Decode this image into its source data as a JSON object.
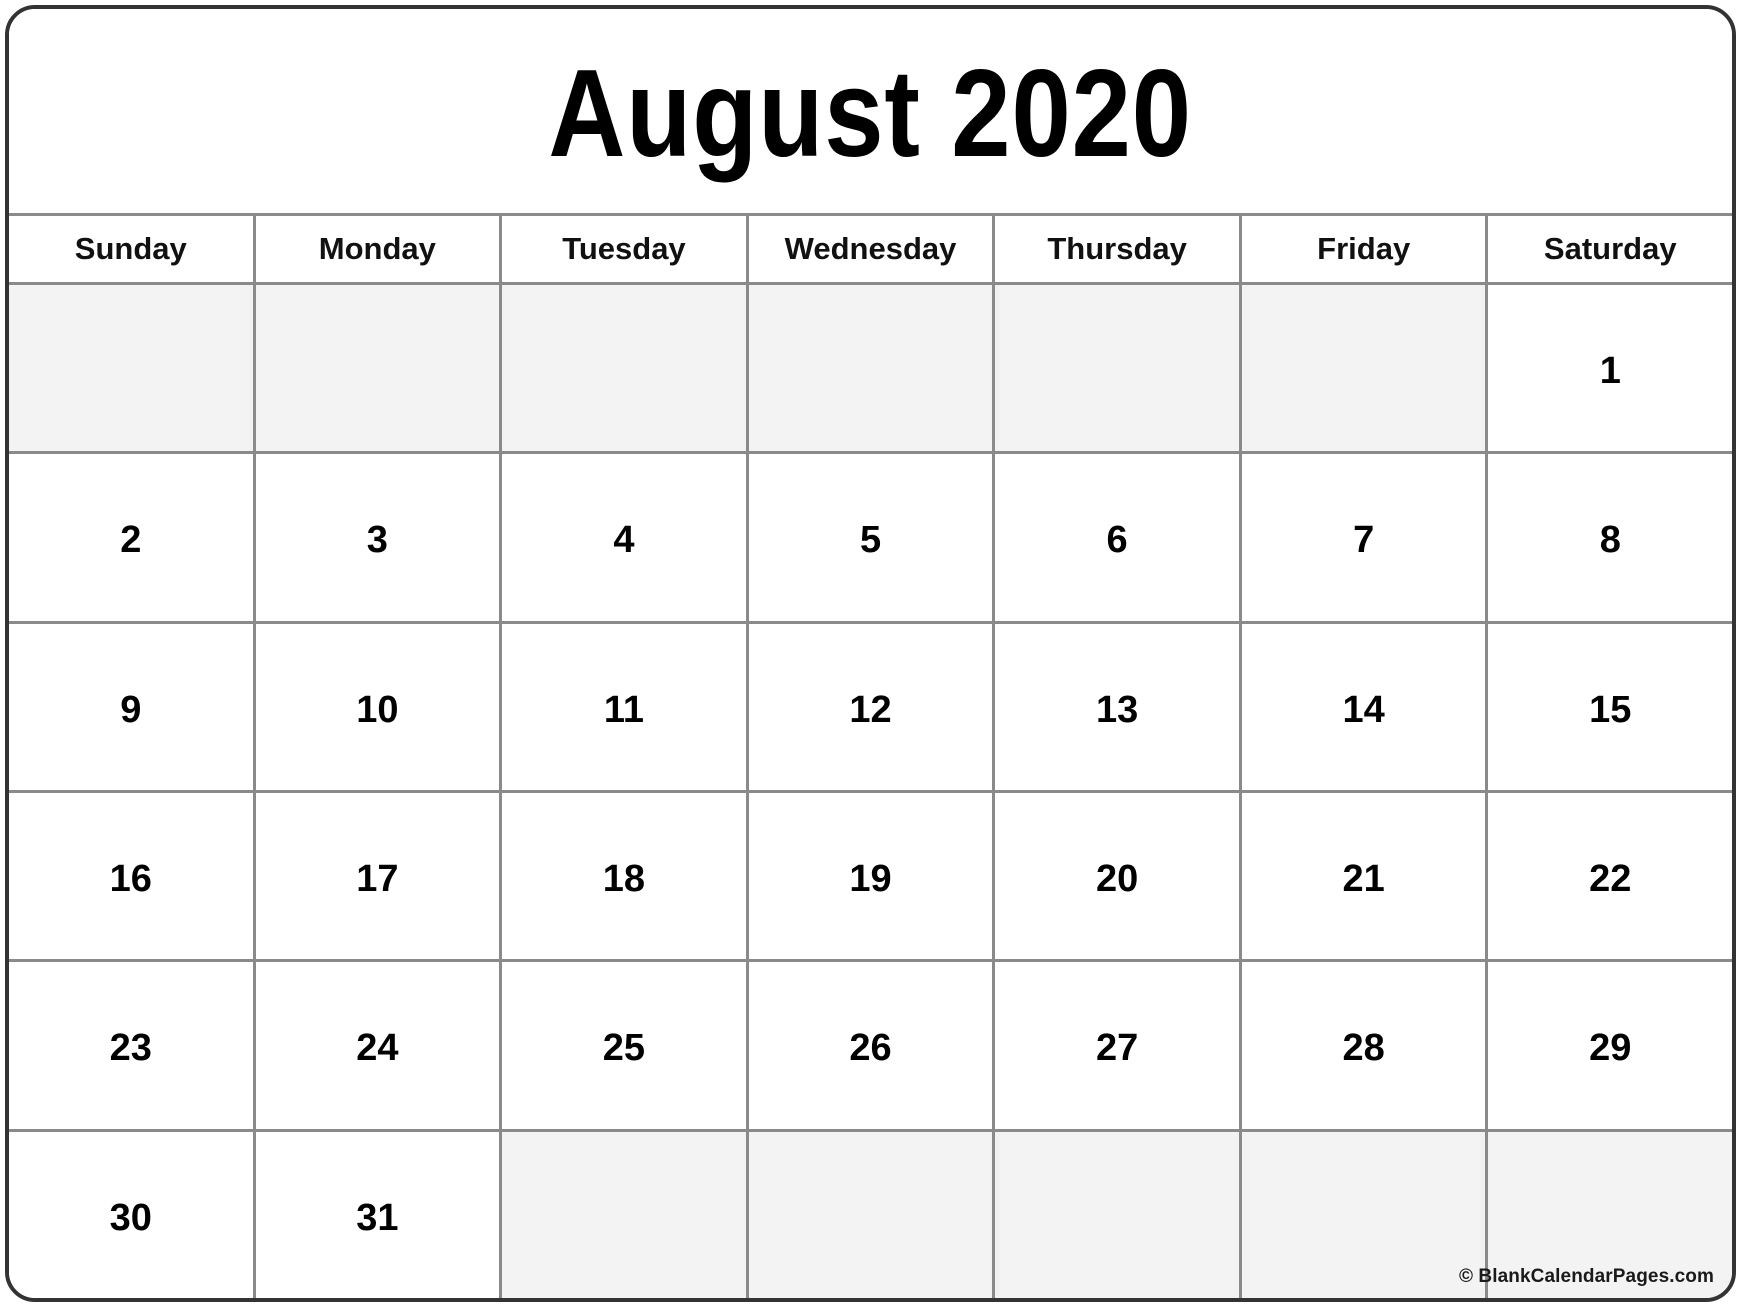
{
  "calendar": {
    "title": "August 2020",
    "month": "August",
    "year": "2020",
    "weekday_headers": [
      "Sunday",
      "Monday",
      "Tuesday",
      "Wednesday",
      "Thursday",
      "Friday",
      "Saturday"
    ],
    "weeks": [
      [
        {
          "day": "",
          "blank": true
        },
        {
          "day": "",
          "blank": true
        },
        {
          "day": "",
          "blank": true
        },
        {
          "day": "",
          "blank": true
        },
        {
          "day": "",
          "blank": true
        },
        {
          "day": "",
          "blank": true
        },
        {
          "day": "1",
          "blank": false
        }
      ],
      [
        {
          "day": "2",
          "blank": false
        },
        {
          "day": "3",
          "blank": false
        },
        {
          "day": "4",
          "blank": false
        },
        {
          "day": "5",
          "blank": false
        },
        {
          "day": "6",
          "blank": false
        },
        {
          "day": "7",
          "blank": false
        },
        {
          "day": "8",
          "blank": false
        }
      ],
      [
        {
          "day": "9",
          "blank": false
        },
        {
          "day": "10",
          "blank": false
        },
        {
          "day": "11",
          "blank": false
        },
        {
          "day": "12",
          "blank": false
        },
        {
          "day": "13",
          "blank": false
        },
        {
          "day": "14",
          "blank": false
        },
        {
          "day": "15",
          "blank": false
        }
      ],
      [
        {
          "day": "16",
          "blank": false
        },
        {
          "day": "17",
          "blank": false
        },
        {
          "day": "18",
          "blank": false
        },
        {
          "day": "19",
          "blank": false
        },
        {
          "day": "20",
          "blank": false
        },
        {
          "day": "21",
          "blank": false
        },
        {
          "day": "22",
          "blank": false
        }
      ],
      [
        {
          "day": "23",
          "blank": false
        },
        {
          "day": "24",
          "blank": false
        },
        {
          "day": "25",
          "blank": false
        },
        {
          "day": "26",
          "blank": false
        },
        {
          "day": "27",
          "blank": false
        },
        {
          "day": "28",
          "blank": false
        },
        {
          "day": "29",
          "blank": false
        }
      ],
      [
        {
          "day": "30",
          "blank": false
        },
        {
          "day": "31",
          "blank": false
        },
        {
          "day": "",
          "blank": true
        },
        {
          "day": "",
          "blank": true
        },
        {
          "day": "",
          "blank": true
        },
        {
          "day": "",
          "blank": true
        },
        {
          "day": "",
          "blank": true
        }
      ]
    ],
    "credit": "© BlankCalendarPages.com",
    "colors": {
      "outer_border": "#333333",
      "grid_line": "#8a8a8a",
      "blank_cell_bg": "#f3f3f3",
      "day_cell_bg": "#ffffff",
      "text": "#000000"
    }
  }
}
